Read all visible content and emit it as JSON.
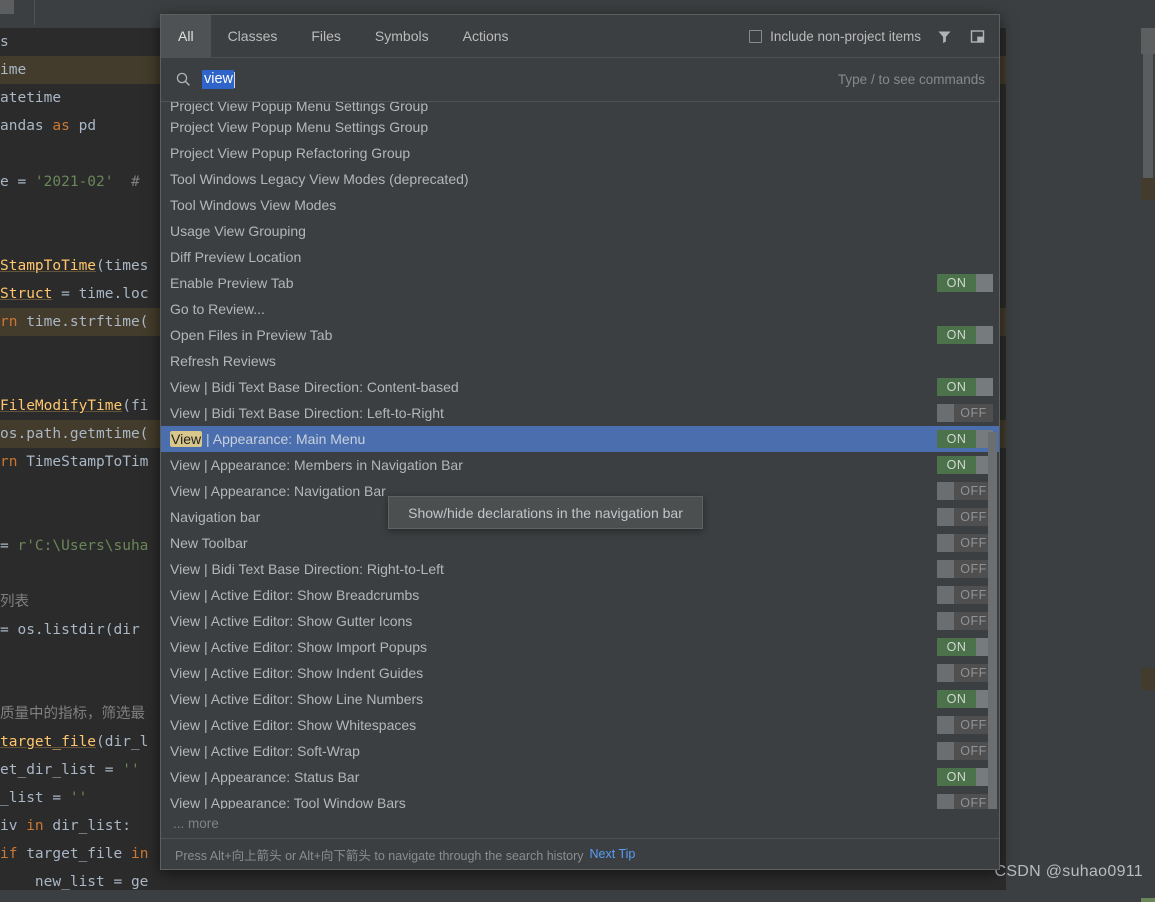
{
  "watermark": "CSDN @suhao0911",
  "editor": {
    "lines": [
      {
        "html": "s",
        "hl": false
      },
      {
        "html": "ime",
        "hl": true
      },
      {
        "html": "atetime",
        "hl": false
      },
      {
        "html": "andas <span class=\"kw\">as</span> pd",
        "hl": false
      },
      {
        "html": "",
        "hl": false
      },
      {
        "html": "e = <span class=\"str\">'2021-02'</span>  <span class=\"cmt\">#</span>",
        "hl": false
      },
      {
        "html": "",
        "hl": false
      },
      {
        "html": "",
        "hl": false
      },
      {
        "html": "<span class=\"fn\">StampToTime</span>(times",
        "hl": false
      },
      {
        "html": "<span class=\"fn\">Struct</span> = time.loc",
        "hl": false
      },
      {
        "html": "<span class=\"kw\">rn</span> time.strftime(",
        "hl": true
      },
      {
        "html": "",
        "hl": false
      },
      {
        "html": "",
        "hl": false
      },
      {
        "html": "<span class=\"fn\">FileModifyTime</span>(fi",
        "hl": false
      },
      {
        "html": "os.path.getmtime(",
        "hl": true
      },
      {
        "html": "<span class=\"kw\">rn</span> TimeStampToTim",
        "hl": false
      },
      {
        "html": "",
        "hl": false
      },
      {
        "html": "",
        "hl": false
      },
      {
        "html": "= <span class=\"str\">r'C:\\Users\\suha</span>",
        "hl": false
      },
      {
        "html": "",
        "hl": false
      },
      {
        "html": "<span class=\"cmt\">列表</span>",
        "hl": false
      },
      {
        "html": "= os.listdir(dir",
        "hl": false
      },
      {
        "html": "",
        "hl": false
      },
      {
        "html": "",
        "hl": false
      },
      {
        "html": "<span class=\"cmt\">质量中的指标，筛选最</span>",
        "hl": false
      },
      {
        "html": "<span class=\"fn\">target_file</span>(dir_l",
        "hl": false
      },
      {
        "html": "et_dir_list = <span class=\"str\">''</span>",
        "hl": false
      },
      {
        "html": "_list = <span class=\"str\">''</span>",
        "hl": false
      },
      {
        "html": "iv <span class=\"kw\">in</span> dir_list:",
        "hl": false
      },
      {
        "html": "<span class=\"kw\">if</span> target_file <span class=\"kw\">in</span>",
        "hl": false
      },
      {
        "html": "    new_list = ge",
        "hl": false
      }
    ]
  },
  "search_everywhere": {
    "tabs": [
      {
        "label": "All",
        "active": true
      },
      {
        "label": "Classes",
        "active": false
      },
      {
        "label": "Files",
        "active": false
      },
      {
        "label": "Symbols",
        "active": false
      },
      {
        "label": "Actions",
        "active": false
      }
    ],
    "include_non_project_label": "Include non-project items",
    "include_non_project_checked": false,
    "filter_icon": "filter-funnel-icon",
    "preview_icon": "preview-panel-icon",
    "search": {
      "icon": "search-icon",
      "value": "view",
      "selected": true,
      "hint": "Type / to see commands"
    },
    "results": [
      {
        "label": "Project View Popup Menu Settings Group",
        "toggle": null,
        "selected": false,
        "clipped": true
      },
      {
        "label": "Project View Popup Menu Settings Group",
        "toggle": null,
        "selected": false
      },
      {
        "label": "Project View Popup Refactoring Group",
        "toggle": null,
        "selected": false
      },
      {
        "label": "Tool Windows Legacy View Modes (deprecated)",
        "toggle": null,
        "selected": false
      },
      {
        "label": "Tool Windows View Modes",
        "toggle": null,
        "selected": false
      },
      {
        "label": "Usage View Grouping",
        "toggle": null,
        "selected": false
      },
      {
        "label": "Diff Preview Location",
        "toggle": null,
        "selected": false
      },
      {
        "label": "Enable Preview Tab",
        "toggle": "ON",
        "selected": false
      },
      {
        "label": "Go to Review...",
        "toggle": null,
        "selected": false
      },
      {
        "label": "Open Files in Preview Tab",
        "toggle": "ON",
        "selected": false
      },
      {
        "label": "Refresh Reviews",
        "toggle": null,
        "selected": false
      },
      {
        "label": "View | Bidi Text Base Direction: Content-based",
        "toggle": "ON",
        "selected": false
      },
      {
        "label": "View | Bidi Text Base Direction: Left-to-Right",
        "toggle": "OFF",
        "selected": false
      },
      {
        "label": "View | Appearance: Main Menu",
        "match": "View",
        "rest": " | Appearance: Main Menu",
        "toggle": "ON",
        "selected": true
      },
      {
        "label": "View | Appearance: Members in Navigation Bar",
        "toggle": "ON",
        "selected": false
      },
      {
        "label": "View | Appearance: Navigation Bar",
        "toggle": "OFF",
        "selected": false
      },
      {
        "label": "Navigation bar",
        "toggle": "OFF",
        "selected": false
      },
      {
        "label": "New Toolbar",
        "toggle": "OFF",
        "selected": false
      },
      {
        "label": "View | Bidi Text Base Direction: Right-to-Left",
        "toggle": "OFF",
        "selected": false
      },
      {
        "label": "View | Active Editor: Show Breadcrumbs",
        "toggle": "OFF",
        "selected": false
      },
      {
        "label": "View | Active Editor: Show Gutter Icons",
        "toggle": "OFF",
        "selected": false
      },
      {
        "label": "View | Active Editor: Show Import Popups",
        "toggle": "ON",
        "selected": false
      },
      {
        "label": "View | Active Editor: Show Indent Guides",
        "toggle": "OFF",
        "selected": false
      },
      {
        "label": "View | Active Editor: Show Line Numbers",
        "toggle": "ON",
        "selected": false
      },
      {
        "label": "View | Active Editor: Show Whitespaces",
        "toggle": "OFF",
        "selected": false
      },
      {
        "label": "View | Active Editor: Soft-Wrap",
        "toggle": "OFF",
        "selected": false
      },
      {
        "label": "View | Appearance: Status Bar",
        "toggle": "ON",
        "selected": false
      },
      {
        "label": "View | Appearance: Tool Window Bars",
        "toggle": "OFF",
        "selected": false
      }
    ],
    "more_label": "... more",
    "footer": {
      "text": "Press Alt+向上箭头 or Alt+向下箭头 to navigate through the search history",
      "link": "Next Tip"
    },
    "tooltip": "Show/hide declarations in the navigation bar"
  },
  "colors": {
    "selection": "#4b6eaf",
    "match_highlight": "#d8c68a",
    "toggle_on": "#4c724c",
    "link": "#589df6",
    "popup_bg": "#3c3f41",
    "editor_bg": "#2b2b2b"
  }
}
